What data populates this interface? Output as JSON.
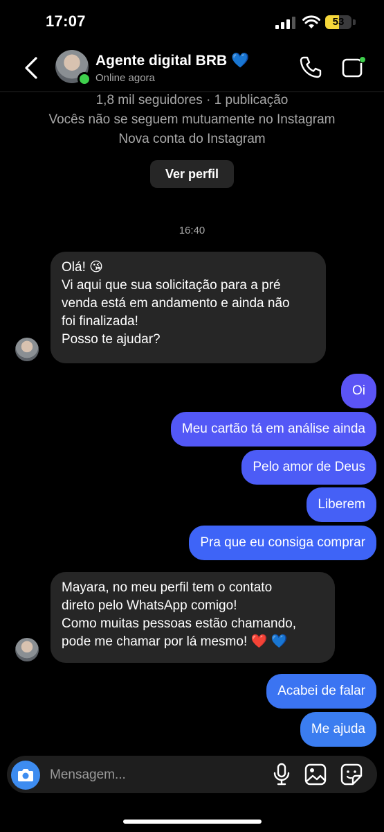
{
  "status_bar": {
    "time": "17:07",
    "battery_level": "53",
    "battery_fraction": 0.53,
    "battery_color": "#f5d73a"
  },
  "header": {
    "contact_name": "Agente digital BRB",
    "name_emoji": "💙",
    "presence": "Online agora",
    "icons": [
      "chevron-left-icon",
      "phone-icon",
      "video-icon"
    ]
  },
  "profile": {
    "followers_line": "1,8 mil seguidores · 1 publicação",
    "mutual_line": "Vocês não se seguem mutuamente no Instagram",
    "new_account_line": "Nova conta do Instagram",
    "view_profile_label": "Ver perfil"
  },
  "chat": {
    "timestamp": "16:40",
    "incoming_1": [
      "Olá! 😘",
      "Vi aqui que sua solicitação para a pré",
      "venda está em andamento e ainda não",
      "foi finalizada!",
      "Posso te ajudar?"
    ],
    "outgoing_1": [
      "Oi",
      "Meu cartão tá em análise ainda",
      "Pelo amor de Deus",
      "Liberem",
      "Pra que eu consiga comprar"
    ],
    "incoming_2": [
      "Mayara, no meu perfil tem o contato",
      "direto pelo WhatsApp comigo!",
      "Como muitas pessoas estão chamando,",
      "pode me chamar por lá mesmo! ❤️ 💙"
    ],
    "outgoing_2": [
      "Acabei de falar",
      "Me ajuda"
    ]
  },
  "composer": {
    "placeholder": "Mensagem...",
    "icons": [
      "camera-icon",
      "microphone-icon",
      "gallery-icon",
      "sticker-icon"
    ]
  },
  "colors": {
    "background": "#000000",
    "incoming_bubble": "#262626",
    "outgoing_bubble_top": "#3b5bfa",
    "outgoing_bubble_bottom": "#3b7df0",
    "online": "#3ecf4c",
    "accent": "#3d8cf0"
  }
}
